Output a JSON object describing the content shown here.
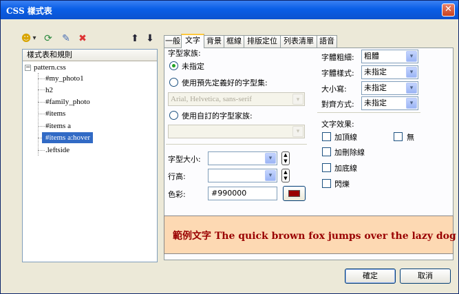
{
  "window": {
    "title": "CSS 樣式表",
    "close_glyph": "✕"
  },
  "toolbar": {
    "icons": [
      "add-rule-icon",
      "refresh-icon",
      "edit-icon",
      "delete-icon",
      "move-up-icon",
      "move-down-icon"
    ],
    "dropdown_arrow": "▾",
    "refresh_glyph": "⟳",
    "edit_glyph": "✎",
    "delete_glyph": "✖",
    "up_glyph": "⬆",
    "down_glyph": "⬇",
    "add_glyph": "☻"
  },
  "tree": {
    "header": "樣式表和規則",
    "expander": "−",
    "root": "pattern.css",
    "items": [
      "#my_photo1",
      "h2",
      "#family_photo",
      "#items",
      "#items a",
      "#items a:hover",
      ".leftside"
    ],
    "selected_index": 5
  },
  "tabs": [
    "一般",
    "文字",
    "背景",
    "框線",
    "排版定位",
    "列表清單",
    "語音"
  ],
  "active_tab": "文字",
  "font_family": {
    "label": "字型家族:",
    "opt_unspecified": "未指定",
    "opt_preset": "使用預先定義好的字型集:",
    "preset_value": "Arial, Helvetica, sans-serif",
    "opt_custom": "使用自訂的字型家族:",
    "custom_value": ""
  },
  "font_size": {
    "label": "字型大小:",
    "value": ""
  },
  "line_height": {
    "label": "行高:",
    "value": ""
  },
  "color": {
    "label": "色彩:",
    "value": "#990000",
    "swatch": "#990000"
  },
  "right": {
    "weight_label": "字體粗細:",
    "weight_value": "粗體",
    "style_label": "字體樣式:",
    "style_value": "未指定",
    "case_label": "大小寫:",
    "case_value": "未指定",
    "align_label": "對齊方式:",
    "align_value": "未指定",
    "effects_label": "文字效果:",
    "overline": "加頂線",
    "none": "無",
    "strike": "加刪除線",
    "underline": "加底線",
    "blink": "閃爍"
  },
  "preview": {
    "text": "範例文字 The quick brown fox jumps over the lazy dog",
    "color": "#990000"
  },
  "buttons": {
    "ok": "確定",
    "cancel": "取消"
  }
}
